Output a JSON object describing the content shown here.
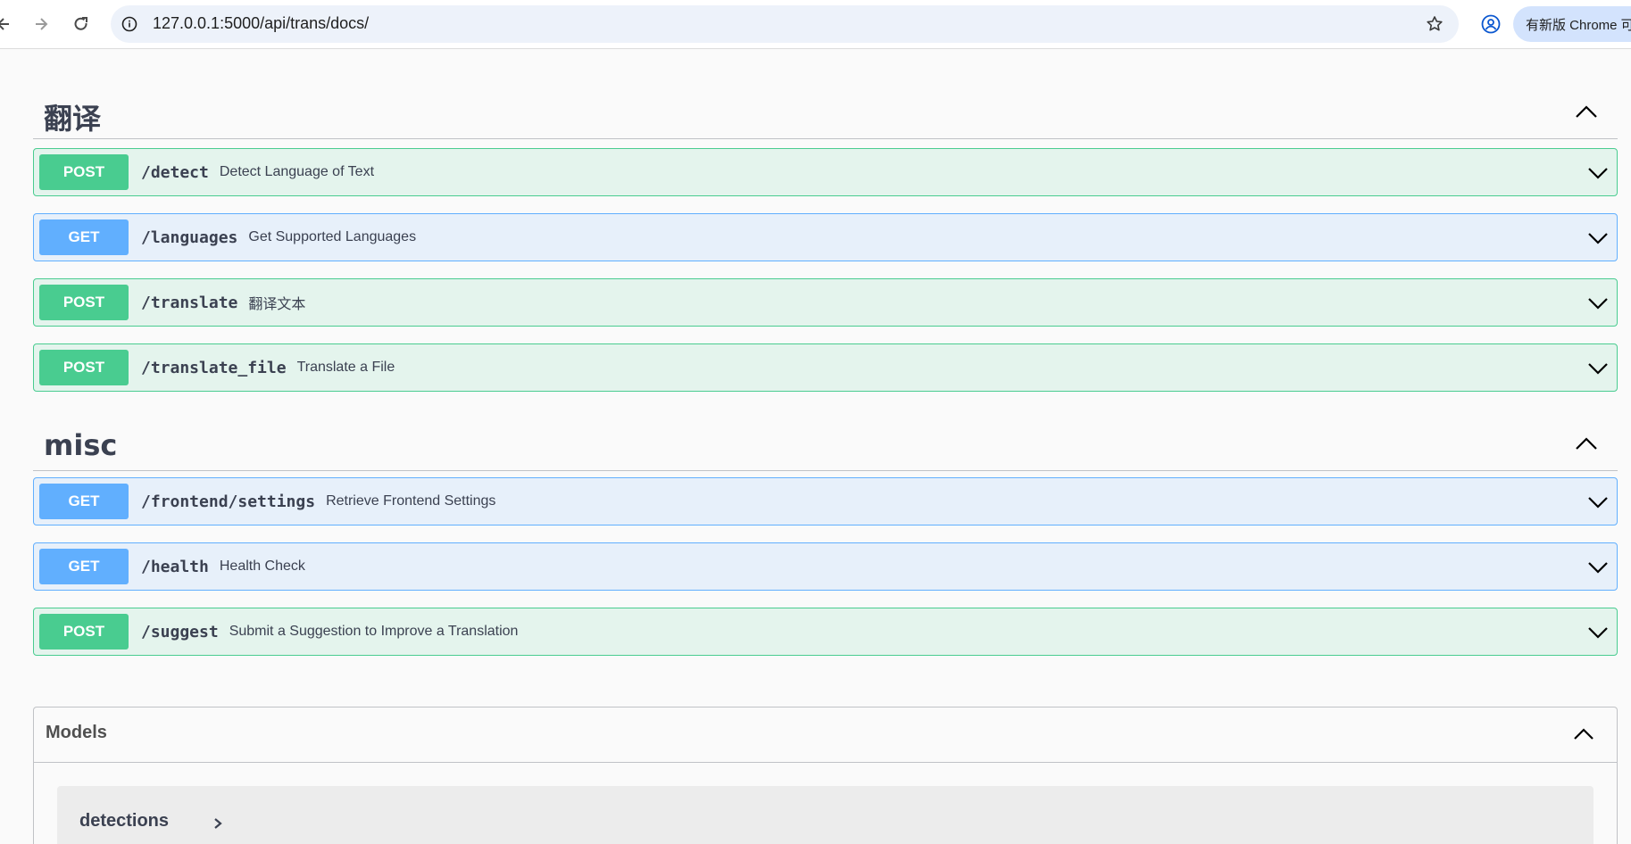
{
  "browser": {
    "url": "127.0.0.1:5000/api/trans/docs/",
    "update_label": "有新版 Chrome 可"
  },
  "colors": {
    "post": "#49cc90",
    "get": "#61affe",
    "text": "#3b4151"
  },
  "sections": [
    {
      "title": "翻译",
      "operations": [
        {
          "method": "POST",
          "path": "/detect",
          "summary": "Detect Language of Text"
        },
        {
          "method": "GET",
          "path": "/languages",
          "summary": "Get Supported Languages"
        },
        {
          "method": "POST",
          "path": "/translate",
          "summary": "翻译文本"
        },
        {
          "method": "POST",
          "path": "/translate_file",
          "summary": "Translate a File"
        }
      ]
    },
    {
      "title": "misc",
      "operations": [
        {
          "method": "GET",
          "path": "/frontend/settings",
          "summary": "Retrieve Frontend Settings"
        },
        {
          "method": "GET",
          "path": "/health",
          "summary": "Health Check"
        },
        {
          "method": "POST",
          "path": "/suggest",
          "summary": "Submit a Suggestion to Improve a Translation"
        }
      ]
    }
  ],
  "models": {
    "title": "Models",
    "items": [
      {
        "name": "detections"
      }
    ]
  }
}
